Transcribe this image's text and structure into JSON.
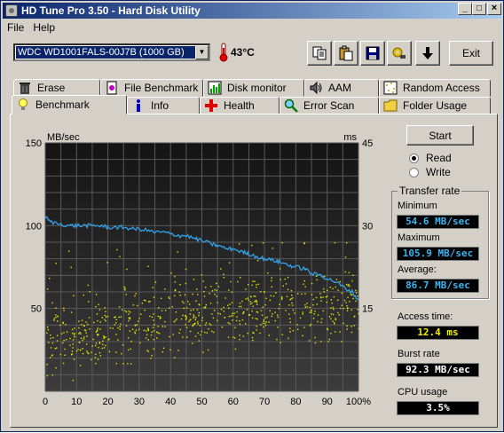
{
  "window": {
    "title": "HD Tune Pro 3.50 - Hard Disk Utility",
    "min_label": "_",
    "max_label": "□",
    "close_label": "×"
  },
  "menu": {
    "file": "File",
    "help": "Help"
  },
  "toolbar": {
    "drive": "WDC WD1001FALS-00J7B (1000 GB)",
    "temperature": "43°C",
    "buttons": [
      "copy-icon",
      "paste-icon",
      "save-icon",
      "options-icon",
      "download-icon"
    ],
    "exit_label": "Exit"
  },
  "tabs_top": [
    {
      "label": "Erase",
      "icon": "trash-icon"
    },
    {
      "label": "File Benchmark",
      "icon": "file-benchmark-icon"
    },
    {
      "label": "Disk monitor",
      "icon": "disk-monitor-icon"
    },
    {
      "label": "AAM",
      "icon": "speaker-icon"
    },
    {
      "label": "Random Access",
      "icon": "random-access-icon"
    }
  ],
  "tabs_bottom": [
    {
      "label": "Benchmark",
      "icon": "lightbulb-icon",
      "active": true
    },
    {
      "label": "Info",
      "icon": "info-icon"
    },
    {
      "label": "Health",
      "icon": "health-cross-icon"
    },
    {
      "label": "Error Scan",
      "icon": "magnifier-icon"
    },
    {
      "label": "Folder Usage",
      "icon": "folder-icon"
    }
  ],
  "controls": {
    "start_label": "Start",
    "read_label": "Read",
    "write_label": "Write",
    "selected_mode": "Read"
  },
  "results": {
    "transfer_rate_title": "Transfer rate",
    "minimum_label": "Minimum",
    "minimum_value": "54.6 MB/sec",
    "maximum_label": "Maximum",
    "maximum_value": "105.9 MB/sec",
    "average_label": "Average:",
    "average_value": "86.7 MB/sec",
    "access_time_label": "Access time:",
    "access_time_value": "12.4 ms",
    "burst_rate_label": "Burst rate",
    "burst_rate_value": "92.3 MB/sec",
    "cpu_usage_label": "CPU usage",
    "cpu_usage_value": "3.5%"
  },
  "chart_data": {
    "type": "line",
    "y_left_unit": "MB/sec",
    "y_right_unit": "ms",
    "y_left_ticks": [
      "150",
      "100",
      "50"
    ],
    "y_right_ticks": [
      "45",
      "30",
      "15"
    ],
    "x_ticks": [
      "0",
      "10",
      "20",
      "30",
      "40",
      "50",
      "60",
      "70",
      "80",
      "90",
      "100%"
    ],
    "xlim": [
      0,
      100
    ],
    "ylim_left": [
      0,
      150
    ],
    "ylim_right": [
      0,
      45
    ],
    "grid": true,
    "colors": {
      "transfer": "#32a0e6",
      "access": "#e6e600",
      "background": "#1e1e1e",
      "grid": "#5a5a5a"
    },
    "series": [
      {
        "axis": "left",
        "x": [
          0,
          2,
          5,
          8,
          10,
          13,
          15,
          18,
          20,
          23,
          25,
          28,
          30,
          33,
          35,
          38,
          40,
          43,
          45,
          48,
          50,
          53,
          55,
          58,
          60,
          63,
          65,
          68,
          70,
          73,
          75,
          78,
          80,
          83,
          85,
          88,
          90,
          93,
          95,
          98,
          100
        ],
        "y": [
          105,
          102,
          101,
          100,
          100,
          100,
          100,
          100,
          99,
          99,
          99,
          98,
          98,
          97,
          96,
          96,
          95,
          94,
          94,
          92,
          91,
          89,
          88,
          86,
          86,
          84,
          83,
          81,
          80,
          79,
          78,
          76,
          75,
          74,
          71,
          70,
          68,
          66,
          63,
          60,
          55
        ]
      },
      {
        "axis": "right",
        "access_time_ms_approx": [
          1,
          26
        ],
        "scatter_trend_ms": [
          [
            0,
            9
          ],
          [
            50,
            14
          ],
          [
            100,
            16
          ]
        ]
      }
    ]
  }
}
